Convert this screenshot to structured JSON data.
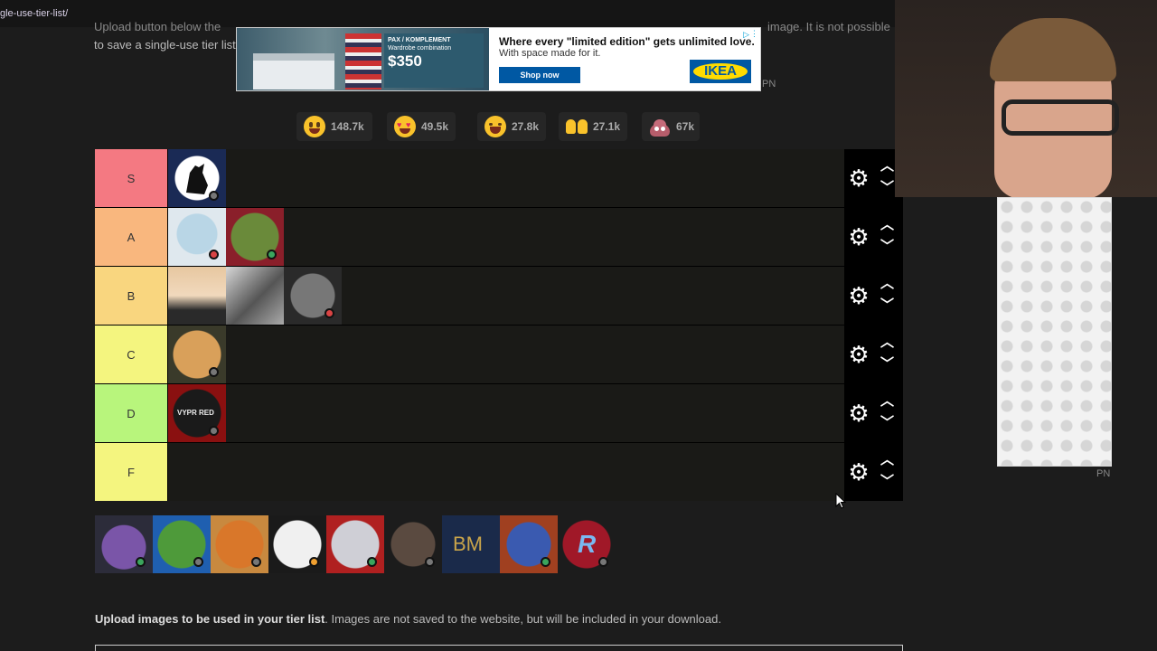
{
  "browser": {
    "url_fragment": "gle-use-tier-list/"
  },
  "intro": {
    "line1_start": "Upload button below the",
    "line1_end": "image. It is not possible",
    "line2": "to save a single-use tier list"
  },
  "ad_banner": {
    "promo_title": "PAX / KOMPLEMENT",
    "promo_sub": "Wardrobe combination",
    "promo_price": "$350",
    "headline": "Where every \"limited edition\" gets unlimited love.",
    "body": "With space made for it.",
    "button": "Shop now",
    "logo": "IKEA",
    "choices_icon": "adchoices-icon",
    "close_icon": "close-icon",
    "pn_label": "PN"
  },
  "reactions": [
    {
      "icon": "smiling-face-icon",
      "count": "148.7k"
    },
    {
      "icon": "heart-eyes-face-icon",
      "count": "49.5k"
    },
    {
      "icon": "laughing-tears-face-icon",
      "count": "27.8k"
    },
    {
      "icon": "raised-hands-icon",
      "count": "27.1k"
    },
    {
      "icon": "pile-of-poo-icon",
      "count": "67k"
    }
  ],
  "tiers": [
    {
      "label": "S",
      "color": "#ff7f7f",
      "items": [
        {
          "name": "wolf-howling-avatar",
          "badge": "gray"
        }
      ]
    },
    {
      "label": "A",
      "color": "#ffbf7f",
      "items": [
        {
          "name": "robot-creature-avatar",
          "badge": "red"
        },
        {
          "name": "cartoon-girl-avatar",
          "badge": "green"
        }
      ]
    },
    {
      "label": "B",
      "color": "#ffdf7f",
      "items": [
        {
          "name": "blonde-woman-avatar",
          "badge": ""
        },
        {
          "name": "batman-sketch-avatar",
          "badge": ""
        },
        {
          "name": "manga-drawing-avatar",
          "badge": "red"
        }
      ]
    },
    {
      "label": "C",
      "color": "#ffff7f",
      "items": [
        {
          "name": "orange-cat-avatar",
          "badge": "gray"
        }
      ]
    },
    {
      "label": "D",
      "color": "#bfff7f",
      "items": [
        {
          "name": "vypr-red-logo-avatar",
          "badge": "gray",
          "text": "VYPR RED"
        }
      ]
    },
    {
      "label": "F",
      "color": "#ffff7f",
      "items": []
    }
  ],
  "controls": {
    "settings_icon": "gear-icon",
    "up_icon": "chevron-up-icon",
    "down_icon": "chevron-down-icon"
  },
  "pool": [
    {
      "name": "purple-hat-character-avatar",
      "badge": "green"
    },
    {
      "name": "pepe-frog-avatar",
      "badge": "gray"
    },
    {
      "name": "flame-avatar",
      "badge": "gray"
    },
    {
      "name": "grinning-cartoon-avatar",
      "badge": "orange"
    },
    {
      "name": "goth-girl-avatar",
      "badge": "green"
    },
    {
      "name": "shaq-avatar",
      "badge": "gray"
    },
    {
      "name": "bm-logo-avatar",
      "badge": "",
      "text": "BM"
    },
    {
      "name": "galaxy-orb-avatar",
      "badge": "green"
    },
    {
      "name": "crowned-r-logo-avatar",
      "badge": "gray",
      "text": "R"
    }
  ],
  "upload": {
    "bold": "Upload images to be used in your tier list",
    "rest": ". Images are not saved to the website, but will be included in your download."
  },
  "side_ad": {
    "pn_label": "PN"
  }
}
